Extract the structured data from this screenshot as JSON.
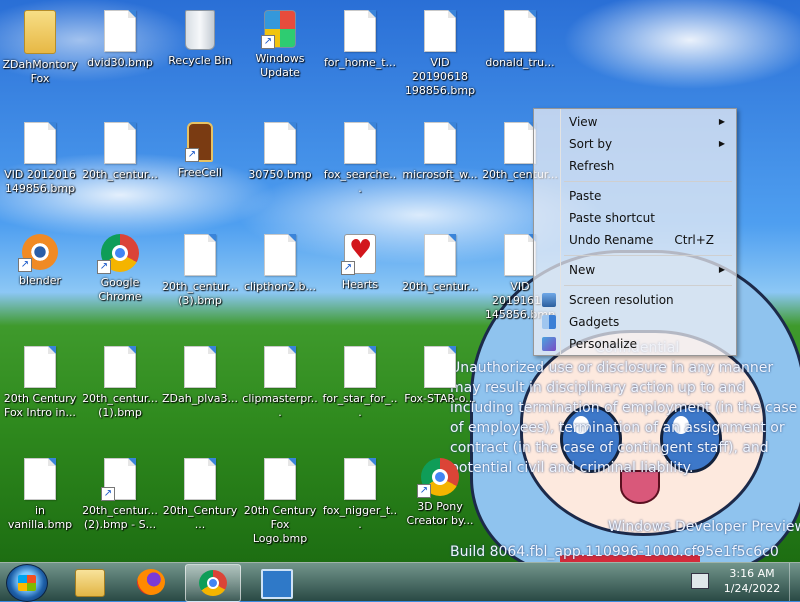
{
  "desktop": {
    "icons": [
      {
        "label": "ZDahMontory Fox",
        "kind": "folder",
        "shortcut": false
      },
      {
        "label": "dvid30.bmp",
        "kind": "file",
        "shortcut": false
      },
      {
        "label": "Recycle Bin",
        "kind": "recycle-bin",
        "shortcut": false
      },
      {
        "label": "Windows Update",
        "kind": "windows-update",
        "shortcut": true
      },
      {
        "label": "for_home_t...",
        "kind": "file",
        "shortcut": false
      },
      {
        "label": "VID 20190618 198856.bmp",
        "kind": "file",
        "shortcut": false
      },
      {
        "label": "donald_tru...",
        "kind": "file",
        "shortcut": false
      },
      {
        "label": "VID 2012016 149856.bmp",
        "kind": "file",
        "shortcut": false
      },
      {
        "label": "20th_centur...",
        "kind": "file",
        "shortcut": false
      },
      {
        "label": "FreeCell",
        "kind": "freecell",
        "shortcut": true
      },
      {
        "label": "30750.bmp",
        "kind": "file",
        "shortcut": false
      },
      {
        "label": "fox_searche...",
        "kind": "file",
        "shortcut": false
      },
      {
        "label": "microsoft_w...",
        "kind": "file",
        "shortcut": false
      },
      {
        "label": "20th_centur...",
        "kind": "file",
        "shortcut": false
      },
      {
        "label": "blender",
        "kind": "blender",
        "shortcut": true
      },
      {
        "label": "Google Chrome",
        "kind": "chrome",
        "shortcut": true
      },
      {
        "label": "20th_centur... (3).bmp",
        "kind": "file",
        "shortcut": false
      },
      {
        "label": "clipthon2.b...",
        "kind": "file",
        "shortcut": false
      },
      {
        "label": "Hearts",
        "kind": "hearts",
        "shortcut": true
      },
      {
        "label": "20th_centur...",
        "kind": "file",
        "shortcut": false
      },
      {
        "label": "VID 20191617 145856.bmp",
        "kind": "file",
        "shortcut": false
      },
      {
        "label": "20th Century Fox Intro in...",
        "kind": "file",
        "shortcut": false
      },
      {
        "label": "20th_centur... (1).bmp",
        "kind": "file",
        "shortcut": false
      },
      {
        "label": "ZDah_plva3...",
        "kind": "file",
        "shortcut": false
      },
      {
        "label": "clipmasterpr...",
        "kind": "file",
        "shortcut": false
      },
      {
        "label": "for_star_for_...",
        "kind": "file",
        "shortcut": false
      },
      {
        "label": "Fox-STAR-o...",
        "kind": "file",
        "shortcut": false
      },
      {
        "label": "in vanilla.bmp",
        "kind": "file",
        "shortcut": false
      },
      {
        "label": "20th_centur... (2).bmp - S...",
        "kind": "file",
        "shortcut": true
      },
      {
        "label": "20th_Century...",
        "kind": "file",
        "shortcut": false
      },
      {
        "label": "20th Century Fox Logo.bmp",
        "kind": "file",
        "shortcut": false
      },
      {
        "label": "fox_nigger_t...",
        "kind": "file",
        "shortcut": false
      },
      {
        "label": "3D Pony Creator by...",
        "kind": "chrome",
        "shortcut": true
      }
    ],
    "watermark": {
      "title": "Confidential",
      "body": "Unauthorized use or disclosure in any manner may result in disciplinary action up to and including termination of employment (in the case of employees), termination of an assignment or contract (in the case of contingent staff), and potential civil and criminal liability.",
      "preview": "Windows Developer Preview",
      "build": "Build 8064.fbl_app.110996-1000.cf95e1f5c6c0"
    }
  },
  "context_menu": {
    "items": [
      {
        "label": "View",
        "submenu": true
      },
      {
        "label": "Sort by",
        "submenu": true
      },
      {
        "label": "Refresh"
      },
      {
        "label": "Paste"
      },
      {
        "label": "Paste shortcut"
      },
      {
        "label": "Undo Rename",
        "shortcut": "Ctrl+Z"
      },
      {
        "label": "New",
        "submenu": true
      },
      {
        "label": "Screen resolution",
        "icon": "screen-resolution-icon"
      },
      {
        "label": "Gadgets",
        "icon": "gadgets-icon"
      },
      {
        "label": "Personalize",
        "icon": "personalize-icon"
      }
    ]
  },
  "taskbar": {
    "pinned": [
      {
        "name": "explorer",
        "icon": "folder-icon"
      },
      {
        "name": "firefox",
        "icon": "firefox-icon"
      },
      {
        "name": "chrome",
        "icon": "chrome-icon",
        "active": true
      },
      {
        "name": "control-panel",
        "icon": "control-panel-icon"
      }
    ],
    "clock": {
      "time": "3:16 AM",
      "date": "1/24/2022"
    }
  },
  "colors": {
    "taskbar": "#2d5a48",
    "menu_bg": "#f0f0f4",
    "desktop_sky": "#3c8be0"
  }
}
